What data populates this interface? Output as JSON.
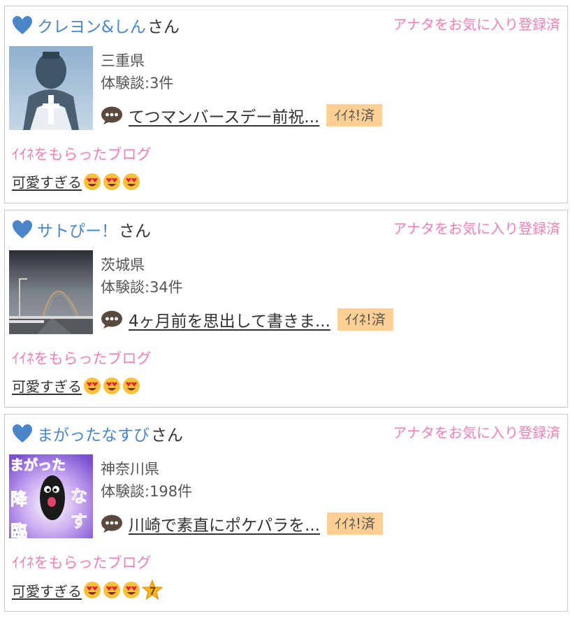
{
  "cards": [
    {
      "user_name": "クレヨン&しん",
      "honorific": "さん",
      "fav_status": "アナタをお気に入り登録済",
      "prefecture": "三重県",
      "experience_count": "体験談:3件",
      "post_title": "てつマンバースデー前祝...",
      "iine_badge": "ｲｲﾈ!済",
      "blog_label": "ｲｲﾈをもらったブログ",
      "blog_title": "可愛すぎる",
      "emojis": [
        "heart-eyes-emoji",
        "heart-eyes-emoji",
        "heart-eyes-emoji"
      ],
      "thumb_icon": "statue-photo"
    },
    {
      "user_name": "サトぴー！",
      "honorific": "さん",
      "fav_status": "アナタをお気に入り登録済",
      "prefecture": "茨城県",
      "experience_count": "体験談:34件",
      "post_title": "4ヶ月前を思出して書きま...",
      "iine_badge": "ｲｲﾈ!済",
      "blog_label": "ｲｲﾈをもらったブログ",
      "blog_title": "可愛すぎる",
      "emojis": [
        "heart-eyes-emoji",
        "heart-eyes-emoji",
        "heart-eyes-emoji"
      ],
      "thumb_icon": "rainbow-road-photo"
    },
    {
      "user_name": "まがったなすび",
      "honorific": "さん",
      "fav_status": "アナタをお気に入り登録済",
      "prefecture": "神奈川県",
      "experience_count": "体験談:198件",
      "post_title": "川崎で素直にポケパラを...",
      "iine_badge": "ｲｲﾈ!済",
      "blog_label": "ｲｲﾈをもらったブログ",
      "blog_title": "可愛すぎる",
      "emojis": [
        "heart-eyes-emoji",
        "heart-eyes-emoji",
        "heart-eyes-emoji",
        "star-badge-emoji"
      ],
      "thumb_icon": "eggplant-avatar",
      "thumb_text": [
        "まがった",
        "降",
        "臨",
        "な",
        "す"
      ]
    }
  ],
  "colors": {
    "accent_pink": "#f07fb5",
    "link_blue": "#4a86c8",
    "badge_bg": "#ffcf94",
    "border": "#c9c9c9"
  }
}
